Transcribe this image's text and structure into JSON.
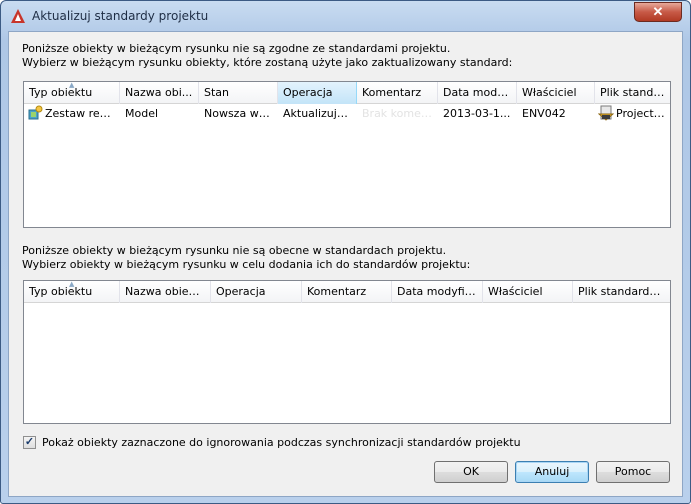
{
  "window": {
    "title": "Aktualizuj standardy projektu",
    "close_label": "✕"
  },
  "top_section": {
    "line1": "Poniższe obiekty w bieżącym rysunku nie są zgodne ze standardami projektu.",
    "line2": "Wybierz w bieżącym rysunku obiekty, które zostaną użyte jako zaktualizowany standard:",
    "columns": [
      "Typ obiektu",
      "Nazwa obi...",
      "Stan",
      "Operacja",
      "Komentarz",
      "Data mody...",
      "Właściciel",
      "Plik standar..."
    ],
    "rows": [
      [
        "Zestaw repr...",
        "Model",
        "Nowsza we...",
        "Aktualizuj s...",
        "Brak komen...",
        "2013-03-1...",
        "ENV042",
        "Project S..."
      ]
    ]
  },
  "bottom_section": {
    "line1": "Poniższe obiekty w bieżącym rysunku nie są obecne w standardach projektu.",
    "line2": "Wybierz obiekty w bieżącym rysunku w celu dodania ich do standardów projektu:",
    "columns": [
      "Typ obiektu",
      "Nazwa obiektu",
      "Operacja",
      "Komentarz",
      "Data modyfikacji",
      "Właściciel",
      "Plik standardó..."
    ]
  },
  "show_ignored": {
    "label": "Pokaż obiekty zaznaczone do ignorowania podczas synchronizacji standardów projektu",
    "checked": true,
    "mark": "✓"
  },
  "buttons": {
    "ok": "OK",
    "cancel": "Anuluj",
    "help": "Pomoc"
  },
  "colors": {
    "accent": "#3c7fb1",
    "header_active": "#c3e4f8",
    "brand_red": "#c8352a"
  },
  "icons": {
    "app": "autocad-logo-icon",
    "row_type": "plot-style-set-icon",
    "row_file": "standards-file-icon"
  }
}
